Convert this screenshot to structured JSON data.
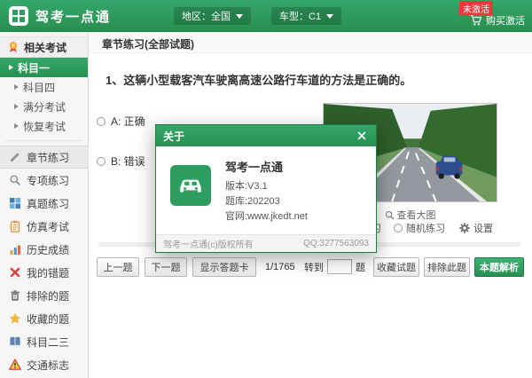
{
  "header": {
    "app_title": "驾考一点通",
    "region": "地区：全国",
    "vehicle": "车型：C1",
    "badge": "未激活",
    "buy": "购买激活"
  },
  "sidebar": {
    "section_label": "相关考试",
    "section_icon": "medal-icon",
    "exam_items": [
      {
        "label": "科目一",
        "active": true
      },
      {
        "label": "科目四",
        "active": false
      },
      {
        "label": "满分考试",
        "active": false
      },
      {
        "label": "恢复考试",
        "active": false
      }
    ],
    "menu_items": [
      {
        "label": "章节练习",
        "icon": "pencil-icon",
        "selected": true
      },
      {
        "label": "专项练习",
        "icon": "magnifier-icon"
      },
      {
        "label": "真题练习",
        "icon": "grid-chart-icon"
      },
      {
        "label": "仿真考试",
        "icon": "clipboard-icon"
      },
      {
        "label": "历史成绩",
        "icon": "bar-chart-icon"
      },
      {
        "label": "我的错题",
        "icon": "red-x-icon"
      },
      {
        "label": "排除的题",
        "icon": "trash-icon"
      },
      {
        "label": "收藏的题",
        "icon": "star-icon"
      },
      {
        "label": "科目二三",
        "icon": "book-icon"
      },
      {
        "label": "交通标志",
        "icon": "warning-sign-icon"
      }
    ]
  },
  "main": {
    "page_title": "章节练习(全部试题)",
    "question": {
      "text": "1、这辆小型载客汽车驶离高速公路行车道的方法是正确的。",
      "options": [
        {
          "key": "A",
          "label": "A: 正确"
        },
        {
          "key": "B",
          "label": "B: 错误"
        }
      ]
    },
    "view_large": "查看大图",
    "modes": [
      {
        "label": "顺序练习"
      },
      {
        "label": "随机练习"
      }
    ],
    "settings": "设置",
    "pager": {
      "prev": "上一题",
      "next": "下一题",
      "card": "显示答题卡",
      "position": "1/1765",
      "goto_prefix": "转到",
      "goto_value": "",
      "goto_suffix": "题"
    },
    "actions": {
      "favorite": "收藏试题",
      "exclude": "排除此题",
      "analysis": "本题解析"
    }
  },
  "dialog": {
    "title": "关于",
    "app_name": "驾考一点通",
    "version": "版本:V3.1",
    "bank": "题库:202203",
    "website": "官网:www.jkedt.net",
    "copyright": "驾考一点通(c)版权所有",
    "qq": "QQ:3277563093"
  },
  "colors": {
    "brand_green": "#2e9e60",
    "header_gradient_top": "#35a76a",
    "header_gradient_bottom": "#27904f",
    "badge_red": "#e23c3c",
    "star_yellow": "#f2b63c"
  }
}
